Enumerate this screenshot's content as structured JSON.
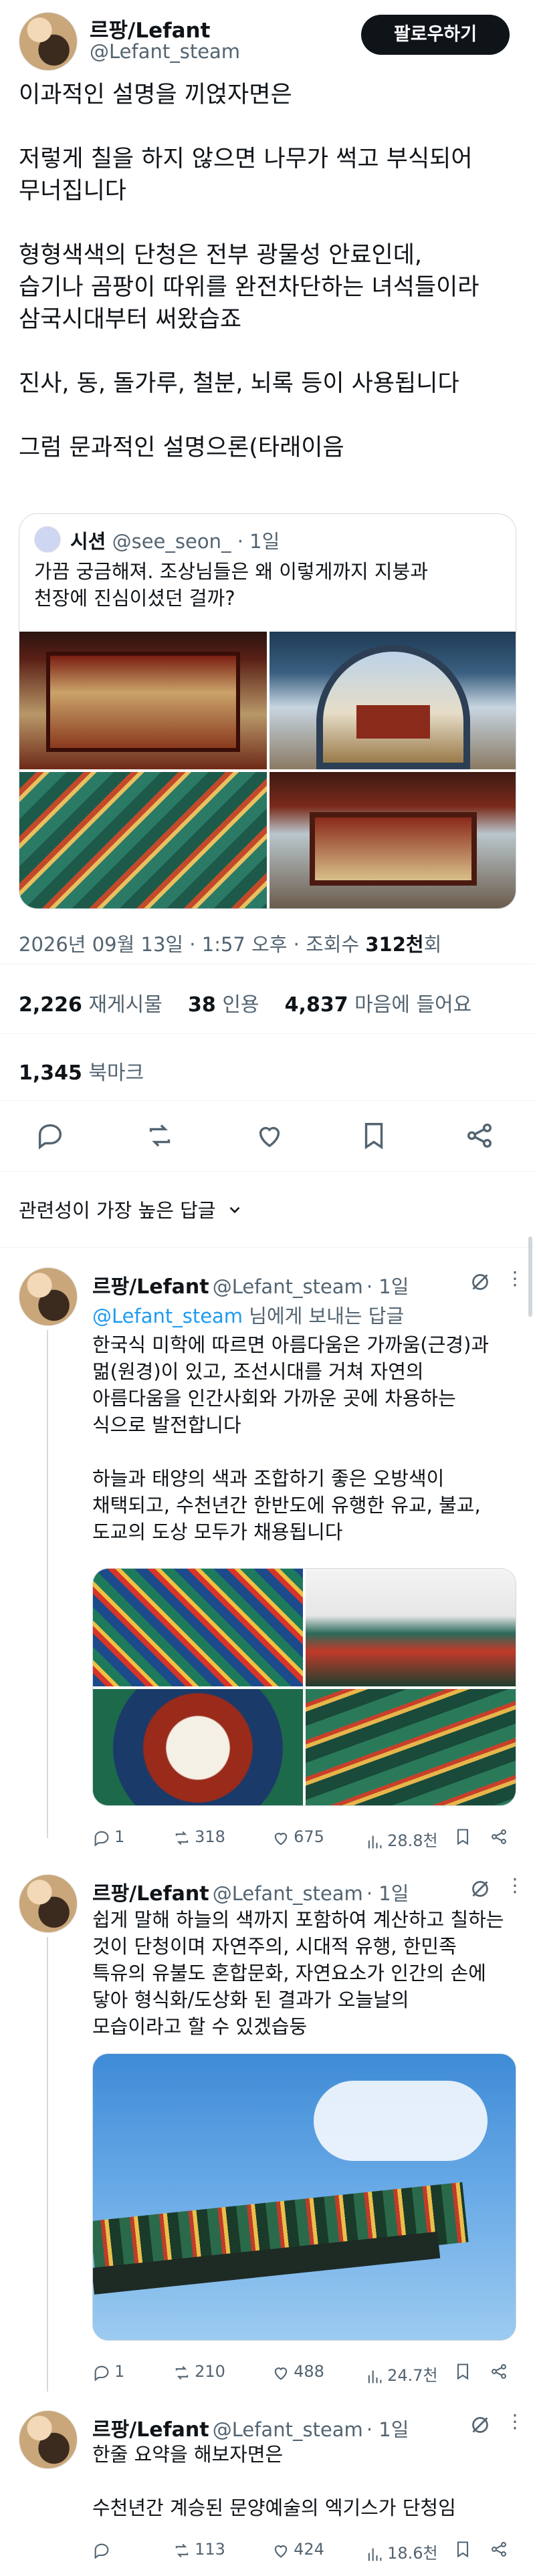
{
  "post": {
    "author_name": "르팡/Lefant",
    "author_handle": "@Lefant_steam",
    "follow_label": "팔로우하기",
    "text_lines": [
      "이과적인 설명을 끼얹자면은",
      "",
      "저렇게 칠을 하지 않으면 나무가 썩고 부식되어",
      "무너집니다",
      "",
      "형형색색의 단청은 전부 광물성 안료인데,",
      "습기나 곰팡이 따위를 완전차단하는 녀석들이라",
      "삼국시대부터 써왔습죠",
      "",
      "진사, 동, 돌가루, 철분, 뇌록 등이 사용됩니다",
      "",
      " 그럼 문과적인 설명으론(타래이음"
    ],
    "quote": {
      "author_name": "시션",
      "author_handle": "@see_seon_",
      "time": "· 1일",
      "text_lines": [
        "가끔 궁금해져. 조상님들은 왜 이렇게까지 지붕과",
        "천장에 진심이셨던 걸까?"
      ]
    },
    "timestamp": "2026년 09월 13일 · 1:57 오후 · 조회수 ",
    "views": "312천",
    "views_suffix": "회",
    "reposts_count": "2,226",
    "reposts_label": "재게시물",
    "quotes_count": "38",
    "quotes_label": "인용",
    "likes_count": "4,837",
    "likes_label": "마음에 들어요",
    "bookmarks_count": "1,345",
    "bookmarks_label": "북마크"
  },
  "replies_header": "관련성이 가장 높은 답글",
  "replies": [
    {
      "author_name": "르팡/Lefant",
      "author_handle": "@Lefant_steam",
      "time": "· 1일",
      "replying_to_handle": "@Lefant_steam",
      "replying_to_suffix": " 님에게 보내는 답글",
      "text_lines": [
        "한국식 미학에 따르면 아름다움은 가까움(근경)과",
        "멂(원경)이 있고, 조선시대를 거쳐 자연의",
        "아름다움을 인간사회와 가까운 곳에 차용하는",
        "식으로 발전합니다",
        "",
        "하늘과 태양의 색과 조합하기 좋은 오방색이",
        "채택되고, 수천년간 한반도에 유행한 유교, 불교,",
        "도교의 도상 모두가 채용됩니다"
      ],
      "replies_count": "1",
      "reposts_count": "318",
      "likes_count": "675",
      "views_count": "28.8천"
    },
    {
      "author_name": "르팡/Lefant",
      "author_handle": "@Lefant_steam",
      "time": "· 1일",
      "text_lines": [
        "쉽게 말해 하늘의 색까지 포함하여 계산하고 칠하는",
        "것이 단청이며 자연주의, 시대적 유행, 한민족",
        "특유의 유불도 혼합문화, 자연요소가 인간의 손에",
        "닿아 형식화/도상화 된 결과가 오늘날의",
        "모습이라고 할 수 있겠습둥"
      ],
      "replies_count": "1",
      "reposts_count": "210",
      "likes_count": "488",
      "views_count": "24.7천"
    },
    {
      "author_name": "르팡/Lefant",
      "author_handle": "@Lefant_steam",
      "time": "· 1일",
      "text_lines": [
        "한줄 요약을 해보자면은",
        "",
        "수천년간 계승된 문양예술의 엑기스가 단청임"
      ],
      "replies_count": "",
      "reposts_count": "113",
      "likes_count": "424",
      "views_count": "18.6천"
    }
  ]
}
